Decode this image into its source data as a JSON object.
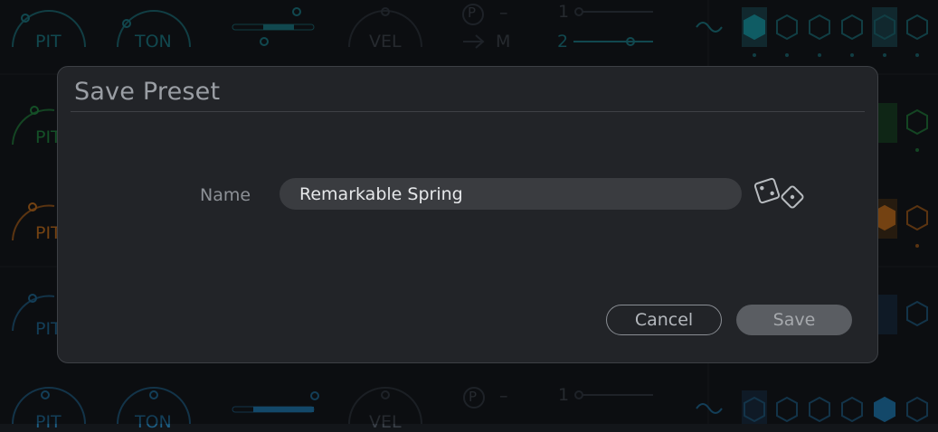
{
  "background": {
    "row_top": {
      "knob_labels": [
        "PIT",
        "TON",
        "VEL"
      ],
      "p_label": "P",
      "p_dash": "–",
      "m_label": "M",
      "slider_numbers": [
        "1",
        "2"
      ]
    },
    "row_green": {
      "knob_label": "PIT"
    },
    "row_orange": {
      "knob_label": "PIT"
    },
    "row_blue": {
      "knob_label": "PIT"
    },
    "row_bottom": {
      "knob_labels": [
        "PIT",
        "TON",
        "VEL"
      ],
      "p_label": "P",
      "p_dash": "–",
      "slider_number": "1"
    },
    "colors": {
      "teal": "#1a6e78",
      "green": "#1f7a3c",
      "orange": "#b0651c",
      "blue": "#1d5f86"
    }
  },
  "dialog": {
    "title": "Save Preset",
    "name_label": "Name",
    "name_value": "Remarkable Spring",
    "randomize_icon": "dice-icon",
    "cancel_label": "Cancel",
    "save_label": "Save"
  }
}
